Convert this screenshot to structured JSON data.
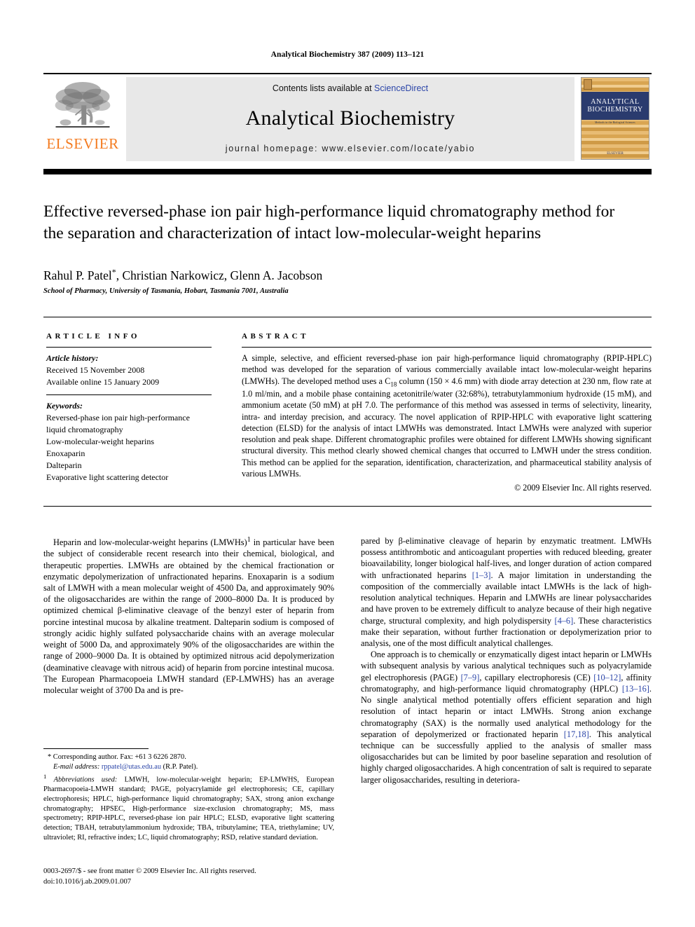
{
  "running_head": "Analytical Biochemistry 387 (2009) 113–121",
  "masthead": {
    "elsevier_wordmark": "ELSEVIER",
    "contents_prefix": "Contents lists available at ",
    "sciencedirect": "ScienceDirect",
    "journal_name": "Analytical Biochemistry",
    "homepage": "journal homepage: www.elsevier.com/locate/yabio",
    "cover": {
      "line1": "ANALYTICAL",
      "line2": "BIOCHEMISTRY",
      "subtitle": "Methods in the Biological Sciences",
      "publisher": "ELSEVIER"
    }
  },
  "article": {
    "title": "Effective reversed-phase ion pair high-performance liquid chromatography method for the separation and characterization of intact low-molecular-weight heparins",
    "authors": "Rahul P. Patel",
    "authors_rest": ", Christian Narkowicz, Glenn A. Jacobson",
    "corresponding_mark": "*",
    "affiliation": "School of Pharmacy, University of Tasmania, Hobart, Tasmania 7001, Australia"
  },
  "article_info": {
    "heading": "ARTICLE INFO",
    "history_label": "Article history:",
    "history": [
      "Received 15 November 2008",
      "Available online 15 January 2009"
    ],
    "keywords_label": "Keywords:",
    "keywords": [
      "Reversed-phase ion pair high-performance",
      "liquid chromatography",
      "Low-molecular-weight heparins",
      "Enoxaparin",
      "Dalteparin",
      "Evaporative light scattering detector"
    ]
  },
  "abstract": {
    "heading": "ABSTRACT",
    "part1": "A simple, selective, and efficient reversed-phase ion pair high-performance liquid chromatography (RPIP-HPLC) method was developed for the separation of various commercially available intact low-molecular-weight heparins (LMWHs). The developed method uses a C",
    "sub": "18",
    "part2": " column (150 × 4.6 mm) with diode array detection at 230 nm, flow rate at 1.0 ml/min, and a mobile phase containing acetonitrile/water (32:68%), tetrabutylammonium hydroxide (15 mM), and ammonium acetate (50 mM) at pH 7.0. The performance of this method was assessed in terms of selectivity, linearity, intra- and interday precision, and accuracy. The novel application of RPIP-HPLC with evaporative light scattering detection (ELSD) for the analysis of intact LMWHs was demonstrated. Intact LMWHs were analyzed with superior resolution and peak shape. Different chromatographic profiles were obtained for different LMWHs showing significant structural diversity. This method clearly showed chemical changes that occurred to LMWH under the stress condition. This method can be applied for the separation, identification, characterization, and pharmaceutical stability analysis of various LMWHs.",
    "copyright": "© 2009 Elsevier Inc. All rights reserved."
  },
  "body": {
    "left_p1_a": "Heparin and low-molecular-weight heparins (LMWHs)",
    "left_p1_sup": "1",
    "left_p1_b": " in particular have been the subject of considerable recent research into their chemical, biological, and therapeutic properties. LMWHs are obtained by the chemical fractionation or enzymatic depolymerization of unfractionated heparins. Enoxaparin is a sodium salt of LMWH with a mean molecular weight of 4500 Da, and approximately 90% of the oligosaccharides are within the range of 2000–8000 Da. It is produced by optimized chemical β-eliminative cleavage of the benzyl ester of heparin from porcine intestinal mucosa by alkaline treatment. Dalteparin sodium is composed of strongly acidic highly sulfated polysaccharide chains with an average molecular weight of 5000 Da, and approximately 90% of the oligosaccharides are within the range of 2000–9000 Da. It is obtained by optimized nitrous acid depolymerization (deaminative cleavage with nitrous acid) of heparin from porcine intestinal mucosa. The European Pharmacopoeia LMWH standard (EP-LMWHS) has an average molecular weight of 3700 Da and is pre-",
    "right_p1_a": "pared by β-eliminative cleavage of heparin by enzymatic treatment. LMWHs possess antithrombotic and anticoagulant properties with reduced bleeding, greater bioavailability, longer biological half-lives, and longer duration of action compared with unfractionated heparins ",
    "right_p1_ref1": "[1–3]",
    "right_p1_b": ". A major limitation in understanding the composition of the commercially available intact LMWHs is the lack of high-resolution analytical techniques. Heparin and LMWHs are linear polysaccharides and have proven to be extremely difficult to analyze because of their high negative charge, structural complexity, and high polydispersity ",
    "right_p1_ref2": "[4–6]",
    "right_p1_c": ". These characteristics make their separation, without further fractionation or depolymerization prior to analysis, one of the most difficult analytical challenges.",
    "right_p2_a": "One approach is to chemically or enzymatically digest intact heparin or LMWHs with subsequent analysis by various analytical techniques such as polyacrylamide gel electrophoresis (PAGE) ",
    "right_p2_ref1": "[7–9]",
    "right_p2_b": ", capillary electrophoresis (CE) ",
    "right_p2_ref2": "[10–12]",
    "right_p2_c": ", affinity chromatography, and high-performance liquid chromatography (HPLC) ",
    "right_p2_ref3": "[13–16]",
    "right_p2_d": ". No single analytical method potentially offers efficient separation and high resolution of intact heparin or intact LMWHs. Strong anion exchange chromatography (SAX) is the normally used analytical methodology for the separation of depolymerized or fractionated heparin ",
    "right_p2_ref4": "[17,18]",
    "right_p2_e": ". This analytical technique can be successfully applied to the analysis of smaller mass oligosaccharides but can be limited by poor baseline separation and resolution of highly charged oligosaccharides. A high concentration of salt is required to separate larger oligosaccharides, resulting in deteriora-"
  },
  "footnotes": {
    "corresponding": "* Corresponding author. Fax: +61 3 6226 2870.",
    "email_label": "E-mail address:",
    "email": "rppatel@utas.edu.au",
    "email_suffix": " (R.P. Patel).",
    "abbrev_sup": "1",
    "abbrev_label": "Abbreviations used:",
    "abbrev_text": " LMWH, low-molecular-weight heparin; EP-LMWHS, European Pharmacopoeia-LMWH standard; PAGE, polyacrylamide gel electrophoresis; CE, capillary electrophoresis; HPLC, high-performance liquid chromatography; SAX, strong anion exchange chromatography; HPSEC, High-performance size-exclusion chromatography; MS, mass spectrometry; RPIP-HPLC, reversed-phase ion pair HPLC; ELSD, evaporative light scattering detection; TBAH, tetrabutylammonium hydroxide; TBA, tributylamine; TEA, triethylamine; UV, ultraviolet; RI, refractive index; LC, liquid chromatography; RSD, relative standard deviation."
  },
  "issn": {
    "line1": "0003-2697/$ - see front matter © 2009 Elsevier Inc. All rights reserved.",
    "line2": "doi:10.1016/j.ab.2009.01.007"
  },
  "colors": {
    "elsevier_orange": "#f47b20",
    "link_blue": "#2b45a8",
    "cover_band": "#2a3b6e",
    "panel_gray": "#e8e8e8"
  }
}
